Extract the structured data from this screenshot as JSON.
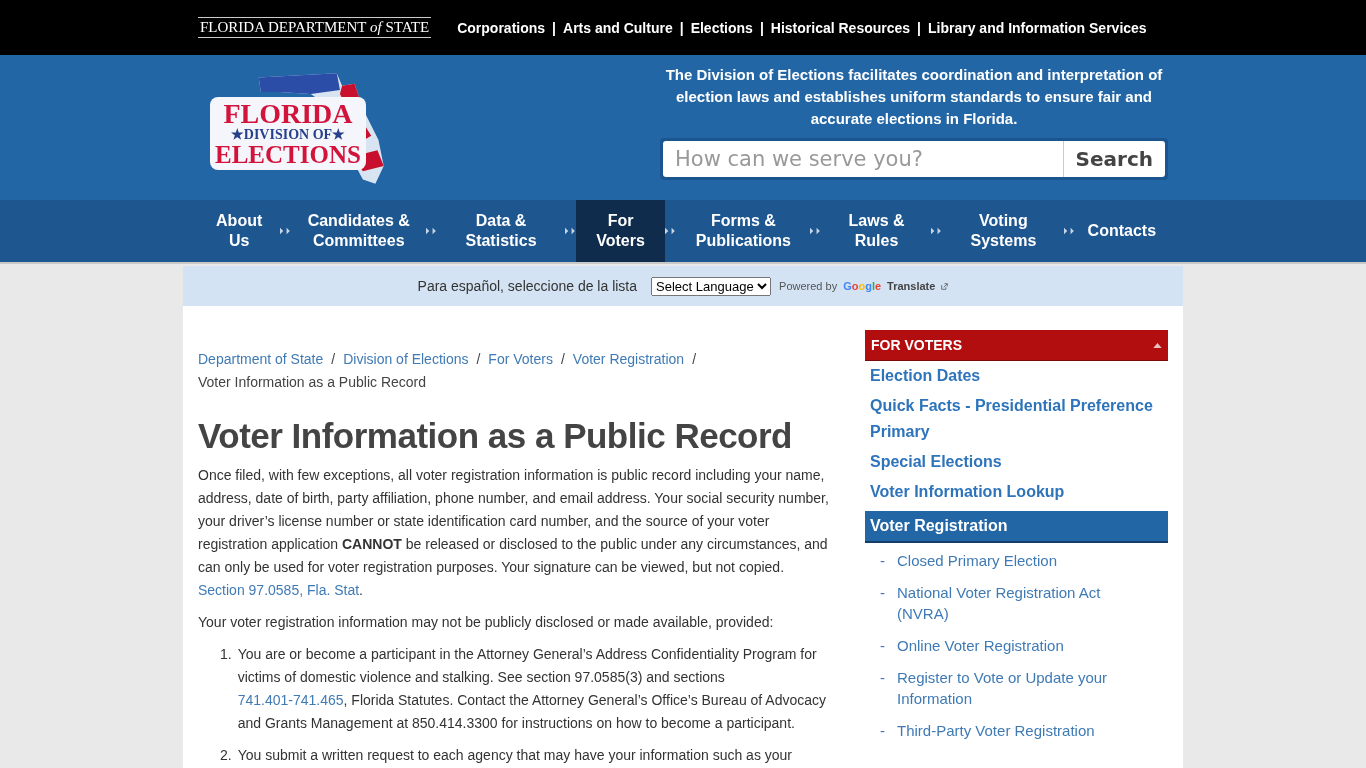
{
  "top_bar": {
    "agency_logo": "FLORIDA DEPARTMENT *of* STATE",
    "separator": "|",
    "links": [
      {
        "label": "Corporations"
      },
      {
        "label": "Arts and Culture"
      },
      {
        "label": "Elections"
      },
      {
        "label": "Historical Resources"
      },
      {
        "label": "Library and Information Services"
      }
    ]
  },
  "header": {
    "logo_lines": [
      "FLORIDA",
      "★DIVISION OF★",
      "ELECTIONS"
    ],
    "mission": "The Division of Elections facilitates coordination and interpretation of election laws and establishes uniform standards to ensure fair and accurate elections in Florida.",
    "search": {
      "placeholder": "How can we serve you?",
      "button": "Search"
    }
  },
  "nav": [
    {
      "label": "About Us",
      "selected": false
    },
    {
      "label": "Candidates & Committees",
      "selected": false
    },
    {
      "label": "Data & Statistics",
      "selected": false
    },
    {
      "label": "For Voters",
      "selected": true
    },
    {
      "label": "Forms & Publications",
      "selected": false
    },
    {
      "label": "Laws & Rules",
      "selected": false
    },
    {
      "label": "Voting Systems",
      "selected": false
    },
    {
      "label": "Contacts",
      "selected": false
    }
  ],
  "translate_bar": {
    "prompt": "Para español, seleccione de la lista",
    "select": "Select Language",
    "powered_by": "Powered by",
    "google": "Google",
    "translate": "Translate"
  },
  "breadcrumb_separator": "/",
  "breadcrumb": [
    {
      "label": "Department of State",
      "link": true
    },
    {
      "label": "Division of Elections",
      "link": true
    },
    {
      "label": "For Voters",
      "link": true
    },
    {
      "label": "Voter Registration",
      "link": true
    },
    {
      "label": "Voter Information as a Public Record",
      "link": false
    }
  ],
  "title": "Voter Information as a Public Record",
  "paragraphs": [
    {
      "text": "Once filed, with few exceptions, all voter registration information is public record including your name, address, date of birth, party affiliation, phone number, and email address. Your social security number, your driver’s license number or state identification card number, and the source of your voter registration application **CANNOT** be released or disclosed to the public under any circumstances, and can only be used for voter registration purposes. Your signature can be viewed, but not copied. ",
      "link": "Section 97.0585, Fla. Stat",
      "after": "."
    },
    {
      "text": "Your voter registration information may not be publicly disclosed or made available, provided:"
    }
  ],
  "list": [
    {
      "number": "1.",
      "text": "You are or become a participant in the Attorney General’s Address Confidentiality Program for victims of domestic violence and stalking. See section 97.0585(3) and sections ",
      "link": "741.401-741.465",
      "after": ", Florida Statutes. Contact the Attorney General’s Office’s Bureau of Advocacy and Grants Management at 850.414.3300 for instructions on how to become a participant."
    },
    {
      "number": "2.",
      "text": "You submit a written request to each agency that may have your information such as your"
    }
  ],
  "sidebar": {
    "title": "FOR VOTERS",
    "expanded": true,
    "sub_bullet": "-",
    "items": [
      {
        "label": "Election Dates",
        "selected": false
      },
      {
        "label": "Quick Facts - Presidential Preference Primary",
        "selected": false
      },
      {
        "label": "Special Elections",
        "selected": false
      },
      {
        "label": "Voter Information Lookup",
        "selected": false
      },
      {
        "label": "Voter Registration",
        "selected": true,
        "children": [
          {
            "label": "Closed Primary Election"
          },
          {
            "label": "National Voter Registration Act (NVRA)"
          },
          {
            "label": "Online Voter Registration"
          },
          {
            "label": "Register to Vote or Update your Information"
          },
          {
            "label": "Third-Party Voter Registration"
          }
        ]
      }
    ]
  }
}
